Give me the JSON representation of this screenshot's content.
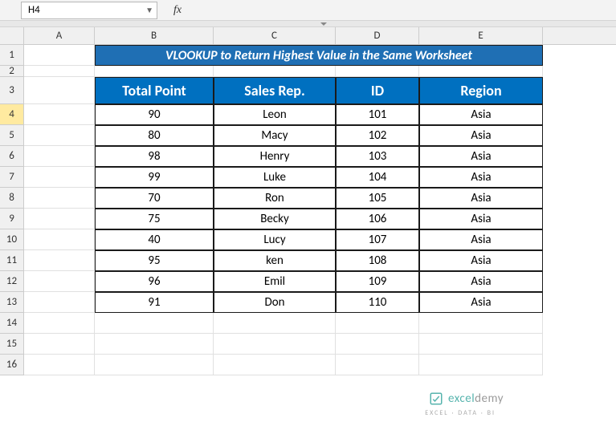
{
  "nameBox": {
    "value": "H4"
  },
  "formulaBar": {
    "fx": "fx",
    "value": ""
  },
  "columns": [
    "A",
    "B",
    "C",
    "D",
    "E"
  ],
  "rows": [
    "1",
    "2",
    "3",
    "4",
    "5",
    "6",
    "7",
    "8",
    "9",
    "10",
    "11",
    "12",
    "13",
    "14",
    "15",
    "16"
  ],
  "selectedRow": "4",
  "title": "VLOOKUP to Return Highest Value in the Same Worksheet",
  "headers": {
    "b": "Total Point",
    "c": "Sales Rep.",
    "d": "ID",
    "e": "Region"
  },
  "data": [
    {
      "b": "90",
      "c": "Leon",
      "d": "101",
      "e": "Asia"
    },
    {
      "b": "80",
      "c": "Macy",
      "d": "102",
      "e": "Asia"
    },
    {
      "b": "98",
      "c": "Henry",
      "d": "103",
      "e": "Asia"
    },
    {
      "b": "99",
      "c": "Luke",
      "d": "104",
      "e": "Asia"
    },
    {
      "b": "70",
      "c": "Ron",
      "d": "105",
      "e": "Asia"
    },
    {
      "b": "75",
      "c": "Becky",
      "d": "106",
      "e": "Asia"
    },
    {
      "b": "40",
      "c": "Lucy",
      "d": "107",
      "e": "Asia"
    },
    {
      "b": "95",
      "c": "ken",
      "d": "108",
      "e": "Asia"
    },
    {
      "b": "96",
      "c": "Emil",
      "d": "109",
      "e": "Asia"
    },
    {
      "b": "91",
      "c": "Don",
      "d": "110",
      "e": "Asia"
    }
  ],
  "watermark": {
    "brand1": "excel",
    "brand2": "demy",
    "sub": "EXCEL · DATA · BI"
  },
  "chart_data": {
    "type": "table",
    "title": "VLOOKUP to Return Highest Value in the Same Worksheet",
    "columns": [
      "Total Point",
      "Sales Rep.",
      "ID",
      "Region"
    ],
    "rows": [
      [
        90,
        "Leon",
        101,
        "Asia"
      ],
      [
        80,
        "Macy",
        102,
        "Asia"
      ],
      [
        98,
        "Henry",
        103,
        "Asia"
      ],
      [
        99,
        "Luke",
        104,
        "Asia"
      ],
      [
        70,
        "Ron",
        105,
        "Asia"
      ],
      [
        75,
        "Becky",
        106,
        "Asia"
      ],
      [
        40,
        "Lucy",
        107,
        "Asia"
      ],
      [
        95,
        "ken",
        108,
        "Asia"
      ],
      [
        96,
        "Emil",
        109,
        "Asia"
      ],
      [
        91,
        "Don",
        110,
        "Asia"
      ]
    ]
  }
}
